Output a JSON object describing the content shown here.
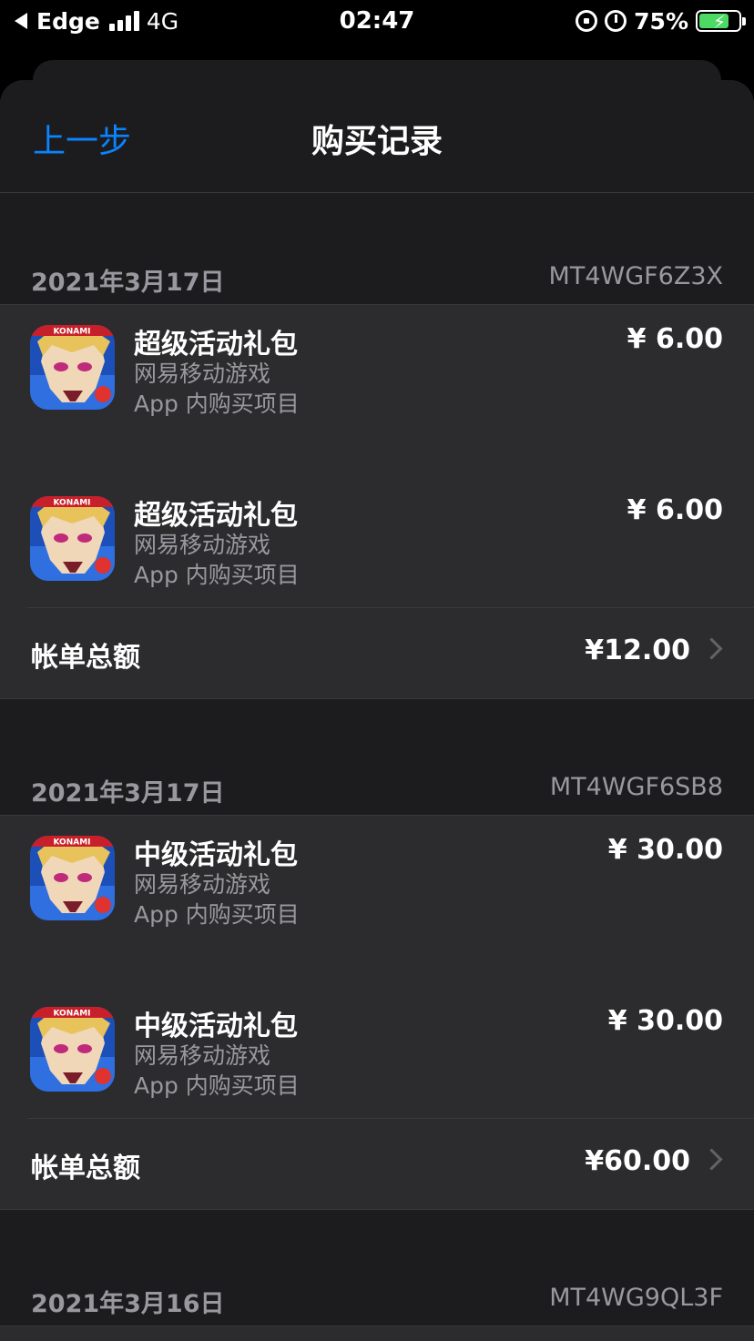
{
  "status_bar": {
    "carrier": "Edge",
    "network": "4G",
    "time": "02:47",
    "battery": "75%",
    "battery_level": 0.75,
    "accent_green": "#4cd964"
  },
  "nav": {
    "back_label": "上一步",
    "title": "购买记录",
    "accent": "#0a84ff"
  },
  "orders": [
    {
      "date": "2021年3月17日",
      "order_id": "MT4WGF6Z3X",
      "items": [
        {
          "name": "超级活动礼包",
          "developer": "网易移动游戏",
          "type": "App 内购买项目",
          "price": "¥ 6.00"
        },
        {
          "name": "超级活动礼包",
          "developer": "网易移动游戏",
          "type": "App 内购买项目",
          "price": "¥ 6.00"
        }
      ],
      "total_label": "帐单总额",
      "total": "¥12.00"
    },
    {
      "date": "2021年3月17日",
      "order_id": "MT4WGF6SB8",
      "items": [
        {
          "name": "中级活动礼包",
          "developer": "网易移动游戏",
          "type": "App 内购买项目",
          "price": "¥ 30.00"
        },
        {
          "name": "中级活动礼包",
          "developer": "网易移动游戏",
          "type": "App 内购买项目",
          "price": "¥ 30.00"
        }
      ],
      "total_label": "帐单总额",
      "total": "¥60.00"
    },
    {
      "date": "2021年3月16日",
      "order_id": "MT4WG9QL3F"
    }
  ],
  "app_icon": {
    "name": "yugioh-game-icon",
    "logo_text": "KONAMI"
  }
}
